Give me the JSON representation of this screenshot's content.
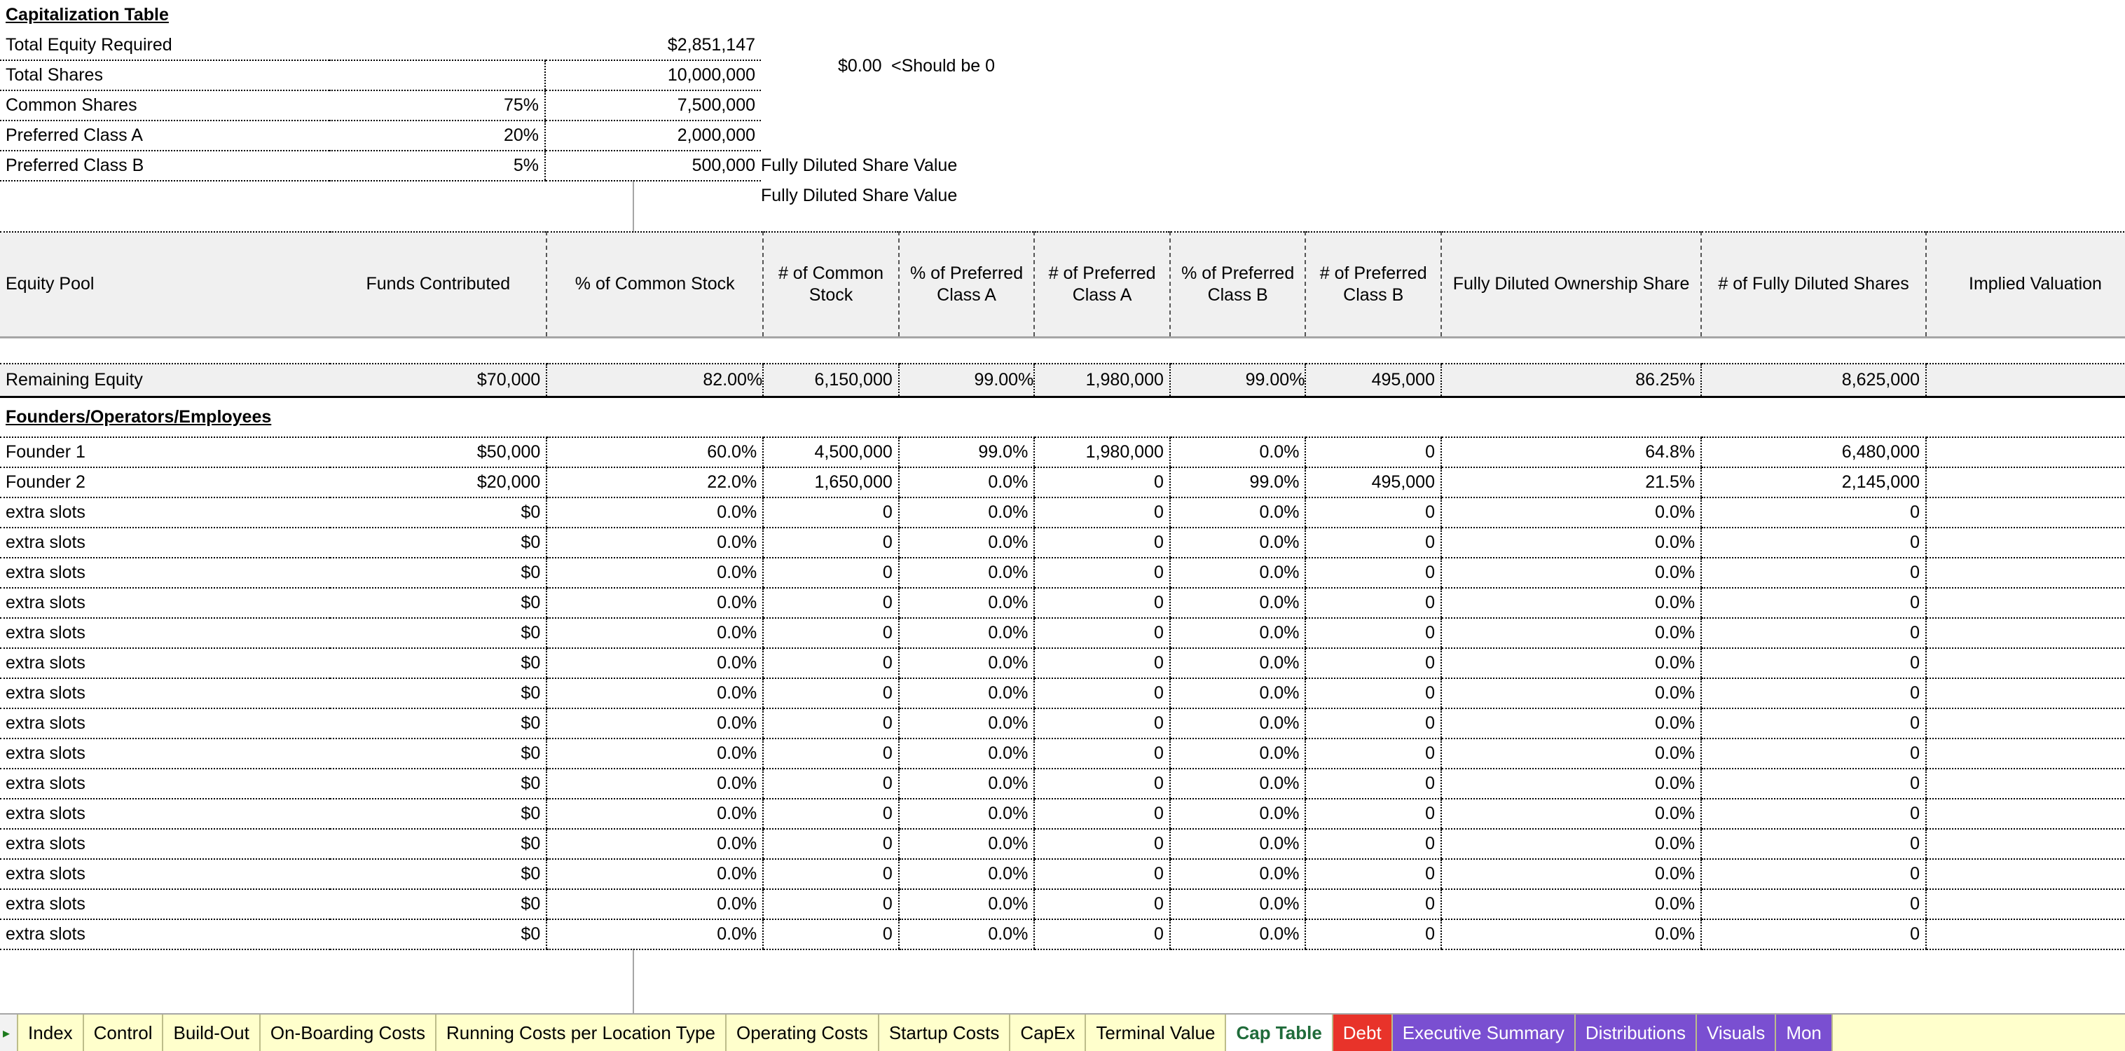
{
  "colors": {
    "input_fill": "#ffffcc",
    "header_fill": "#f0f0f0",
    "formula_text": "#1414d2",
    "comment_marker": "#178a17",
    "tab_bar_fill": "#ffffcc",
    "tab_red": "#e8332a",
    "tab_purple": "#7a4fd1",
    "active_tab_text": "#1f6b3a"
  },
  "summary": {
    "title": "Capitalization Table",
    "rows": [
      {
        "label": "Total Equity Required",
        "pct": "",
        "value": "$2,851,147",
        "note": ""
      },
      {
        "label": "Total Shares",
        "pct": "",
        "value": "10,000,000",
        "note": ""
      },
      {
        "label": "Common Shares",
        "pct": "75%",
        "value": "7,500,000",
        "note": ""
      },
      {
        "label": "Preferred Class A",
        "pct": "20%",
        "value": "2,000,000",
        "note": "Fully Diluted Share Value"
      },
      {
        "label": "Preferred Class B",
        "pct": "5%",
        "value": "500,000",
        "note": "Fully Diluted Share Value"
      }
    ],
    "check_value": "$0.00",
    "check_note": "<Should be 0"
  },
  "table": {
    "headers": [
      "Equity Pool",
      "Funds Contributed",
      "% of Common Stock",
      "# of Common Stock",
      "% of Preferred Class A",
      "# of Preferred Class A",
      "% of Preferred Class B",
      "# of Preferred Class B",
      "Fully Diluted Ownership Share",
      "# of Fully Diluted Shares",
      "Implied Valuation"
    ],
    "remaining": {
      "label": "Remaining Equity",
      "funds": "$70,000",
      "pct_common": "82.00%",
      "num_common": "6,150,000",
      "pct_pref_a": "99.00%",
      "num_pref_a": "1,980,000",
      "pct_pref_b": "99.00%",
      "num_pref_b": "495,000",
      "fd_ownership": "86.25%",
      "fd_shares": "8,625,000",
      "implied": ""
    },
    "section_label": "Founders/Operators/Employees",
    "rows": [
      {
        "name": "Founder 1",
        "funds": "$50,000",
        "pct_common": "60.0%",
        "num_common": "4,500,000",
        "pct_pref_a": "99.0%",
        "num_pref_a": "1,980,000",
        "pct_pref_b": "0.0%",
        "num_pref_b": "0",
        "fd_ownership": "64.8%",
        "fd_shares": "6,480,000",
        "implied": "$"
      },
      {
        "name": "Founder 2",
        "funds": "$20,000",
        "pct_common": "22.0%",
        "num_common": "1,650,000",
        "pct_pref_a": "0.0%",
        "num_pref_a": "0",
        "pct_pref_b": "99.0%",
        "num_pref_b": "495,000",
        "fd_ownership": "21.5%",
        "fd_shares": "2,145,000",
        "implied": "$"
      },
      {
        "name": "extra slots",
        "funds": "$0",
        "pct_common": "0.0%",
        "num_common": "0",
        "pct_pref_a": "0.0%",
        "num_pref_a": "0",
        "pct_pref_b": "0.0%",
        "num_pref_b": "0",
        "fd_ownership": "0.0%",
        "fd_shares": "0",
        "implied": ""
      },
      {
        "name": "extra slots",
        "funds": "$0",
        "pct_common": "0.0%",
        "num_common": "0",
        "pct_pref_a": "0.0%",
        "num_pref_a": "0",
        "pct_pref_b": "0.0%",
        "num_pref_b": "0",
        "fd_ownership": "0.0%",
        "fd_shares": "0",
        "implied": ""
      },
      {
        "name": "extra slots",
        "funds": "$0",
        "pct_common": "0.0%",
        "num_common": "0",
        "pct_pref_a": "0.0%",
        "num_pref_a": "0",
        "pct_pref_b": "0.0%",
        "num_pref_b": "0",
        "fd_ownership": "0.0%",
        "fd_shares": "0",
        "implied": ""
      },
      {
        "name": "extra slots",
        "funds": "$0",
        "pct_common": "0.0%",
        "num_common": "0",
        "pct_pref_a": "0.0%",
        "num_pref_a": "0",
        "pct_pref_b": "0.0%",
        "num_pref_b": "0",
        "fd_ownership": "0.0%",
        "fd_shares": "0",
        "implied": ""
      },
      {
        "name": "extra slots",
        "funds": "$0",
        "pct_common": "0.0%",
        "num_common": "0",
        "pct_pref_a": "0.0%",
        "num_pref_a": "0",
        "pct_pref_b": "0.0%",
        "num_pref_b": "0",
        "fd_ownership": "0.0%",
        "fd_shares": "0",
        "implied": ""
      },
      {
        "name": "extra slots",
        "funds": "$0",
        "pct_common": "0.0%",
        "num_common": "0",
        "pct_pref_a": "0.0%",
        "num_pref_a": "0",
        "pct_pref_b": "0.0%",
        "num_pref_b": "0",
        "fd_ownership": "0.0%",
        "fd_shares": "0",
        "implied": ""
      },
      {
        "name": "extra slots",
        "funds": "$0",
        "pct_common": "0.0%",
        "num_common": "0",
        "pct_pref_a": "0.0%",
        "num_pref_a": "0",
        "pct_pref_b": "0.0%",
        "num_pref_b": "0",
        "fd_ownership": "0.0%",
        "fd_shares": "0",
        "implied": ""
      },
      {
        "name": "extra slots",
        "funds": "$0",
        "pct_common": "0.0%",
        "num_common": "0",
        "pct_pref_a": "0.0%",
        "num_pref_a": "0",
        "pct_pref_b": "0.0%",
        "num_pref_b": "0",
        "fd_ownership": "0.0%",
        "fd_shares": "0",
        "implied": ""
      },
      {
        "name": "extra slots",
        "funds": "$0",
        "pct_common": "0.0%",
        "num_common": "0",
        "pct_pref_a": "0.0%",
        "num_pref_a": "0",
        "pct_pref_b": "0.0%",
        "num_pref_b": "0",
        "fd_ownership": "0.0%",
        "fd_shares": "0",
        "implied": ""
      },
      {
        "name": "extra slots",
        "funds": "$0",
        "pct_common": "0.0%",
        "num_common": "0",
        "pct_pref_a": "0.0%",
        "num_pref_a": "0",
        "pct_pref_b": "0.0%",
        "num_pref_b": "0",
        "fd_ownership": "0.0%",
        "fd_shares": "0",
        "implied": ""
      },
      {
        "name": "extra slots",
        "funds": "$0",
        "pct_common": "0.0%",
        "num_common": "0",
        "pct_pref_a": "0.0%",
        "num_pref_a": "0",
        "pct_pref_b": "0.0%",
        "num_pref_b": "0",
        "fd_ownership": "0.0%",
        "fd_shares": "0",
        "implied": ""
      },
      {
        "name": "extra slots",
        "funds": "$0",
        "pct_common": "0.0%",
        "num_common": "0",
        "pct_pref_a": "0.0%",
        "num_pref_a": "0",
        "pct_pref_b": "0.0%",
        "num_pref_b": "0",
        "fd_ownership": "0.0%",
        "fd_shares": "0",
        "implied": ""
      },
      {
        "name": "extra slots",
        "funds": "$0",
        "pct_common": "0.0%",
        "num_common": "0",
        "pct_pref_a": "0.0%",
        "num_pref_a": "0",
        "pct_pref_b": "0.0%",
        "num_pref_b": "0",
        "fd_ownership": "0.0%",
        "fd_shares": "0",
        "implied": ""
      },
      {
        "name": "extra slots",
        "funds": "$0",
        "pct_common": "0.0%",
        "num_common": "0",
        "pct_pref_a": "0.0%",
        "num_pref_a": "0",
        "pct_pref_b": "0.0%",
        "num_pref_b": "0",
        "fd_ownership": "0.0%",
        "fd_shares": "0",
        "implied": ""
      },
      {
        "name": "extra slots",
        "funds": "$0",
        "pct_common": "0.0%",
        "num_common": "0",
        "pct_pref_a": "0.0%",
        "num_pref_a": "0",
        "pct_pref_b": "0.0%",
        "num_pref_b": "0",
        "fd_ownership": "0.0%",
        "fd_shares": "0",
        "implied": ""
      }
    ]
  },
  "tabs": [
    {
      "label": "Index",
      "style": "plain"
    },
    {
      "label": "Control",
      "style": "plain"
    },
    {
      "label": "Build-Out",
      "style": "plain"
    },
    {
      "label": "On-Boarding Costs",
      "style": "plain"
    },
    {
      "label": "Running Costs per Location Type",
      "style": "plain"
    },
    {
      "label": "Operating Costs",
      "style": "plain"
    },
    {
      "label": "Startup Costs",
      "style": "plain"
    },
    {
      "label": "CapEx",
      "style": "plain"
    },
    {
      "label": "Terminal Value",
      "style": "plain"
    },
    {
      "label": "Cap Table",
      "style": "active"
    },
    {
      "label": "Debt",
      "style": "red"
    },
    {
      "label": "Executive Summary",
      "style": "purple"
    },
    {
      "label": "Distributions",
      "style": "purple"
    },
    {
      "label": "Visuals",
      "style": "purple"
    },
    {
      "label": "Mon",
      "style": "purple"
    }
  ],
  "nav": {
    "prev_icon": "triangle-left-icon",
    "next_icon": "triangle-right-icon"
  }
}
